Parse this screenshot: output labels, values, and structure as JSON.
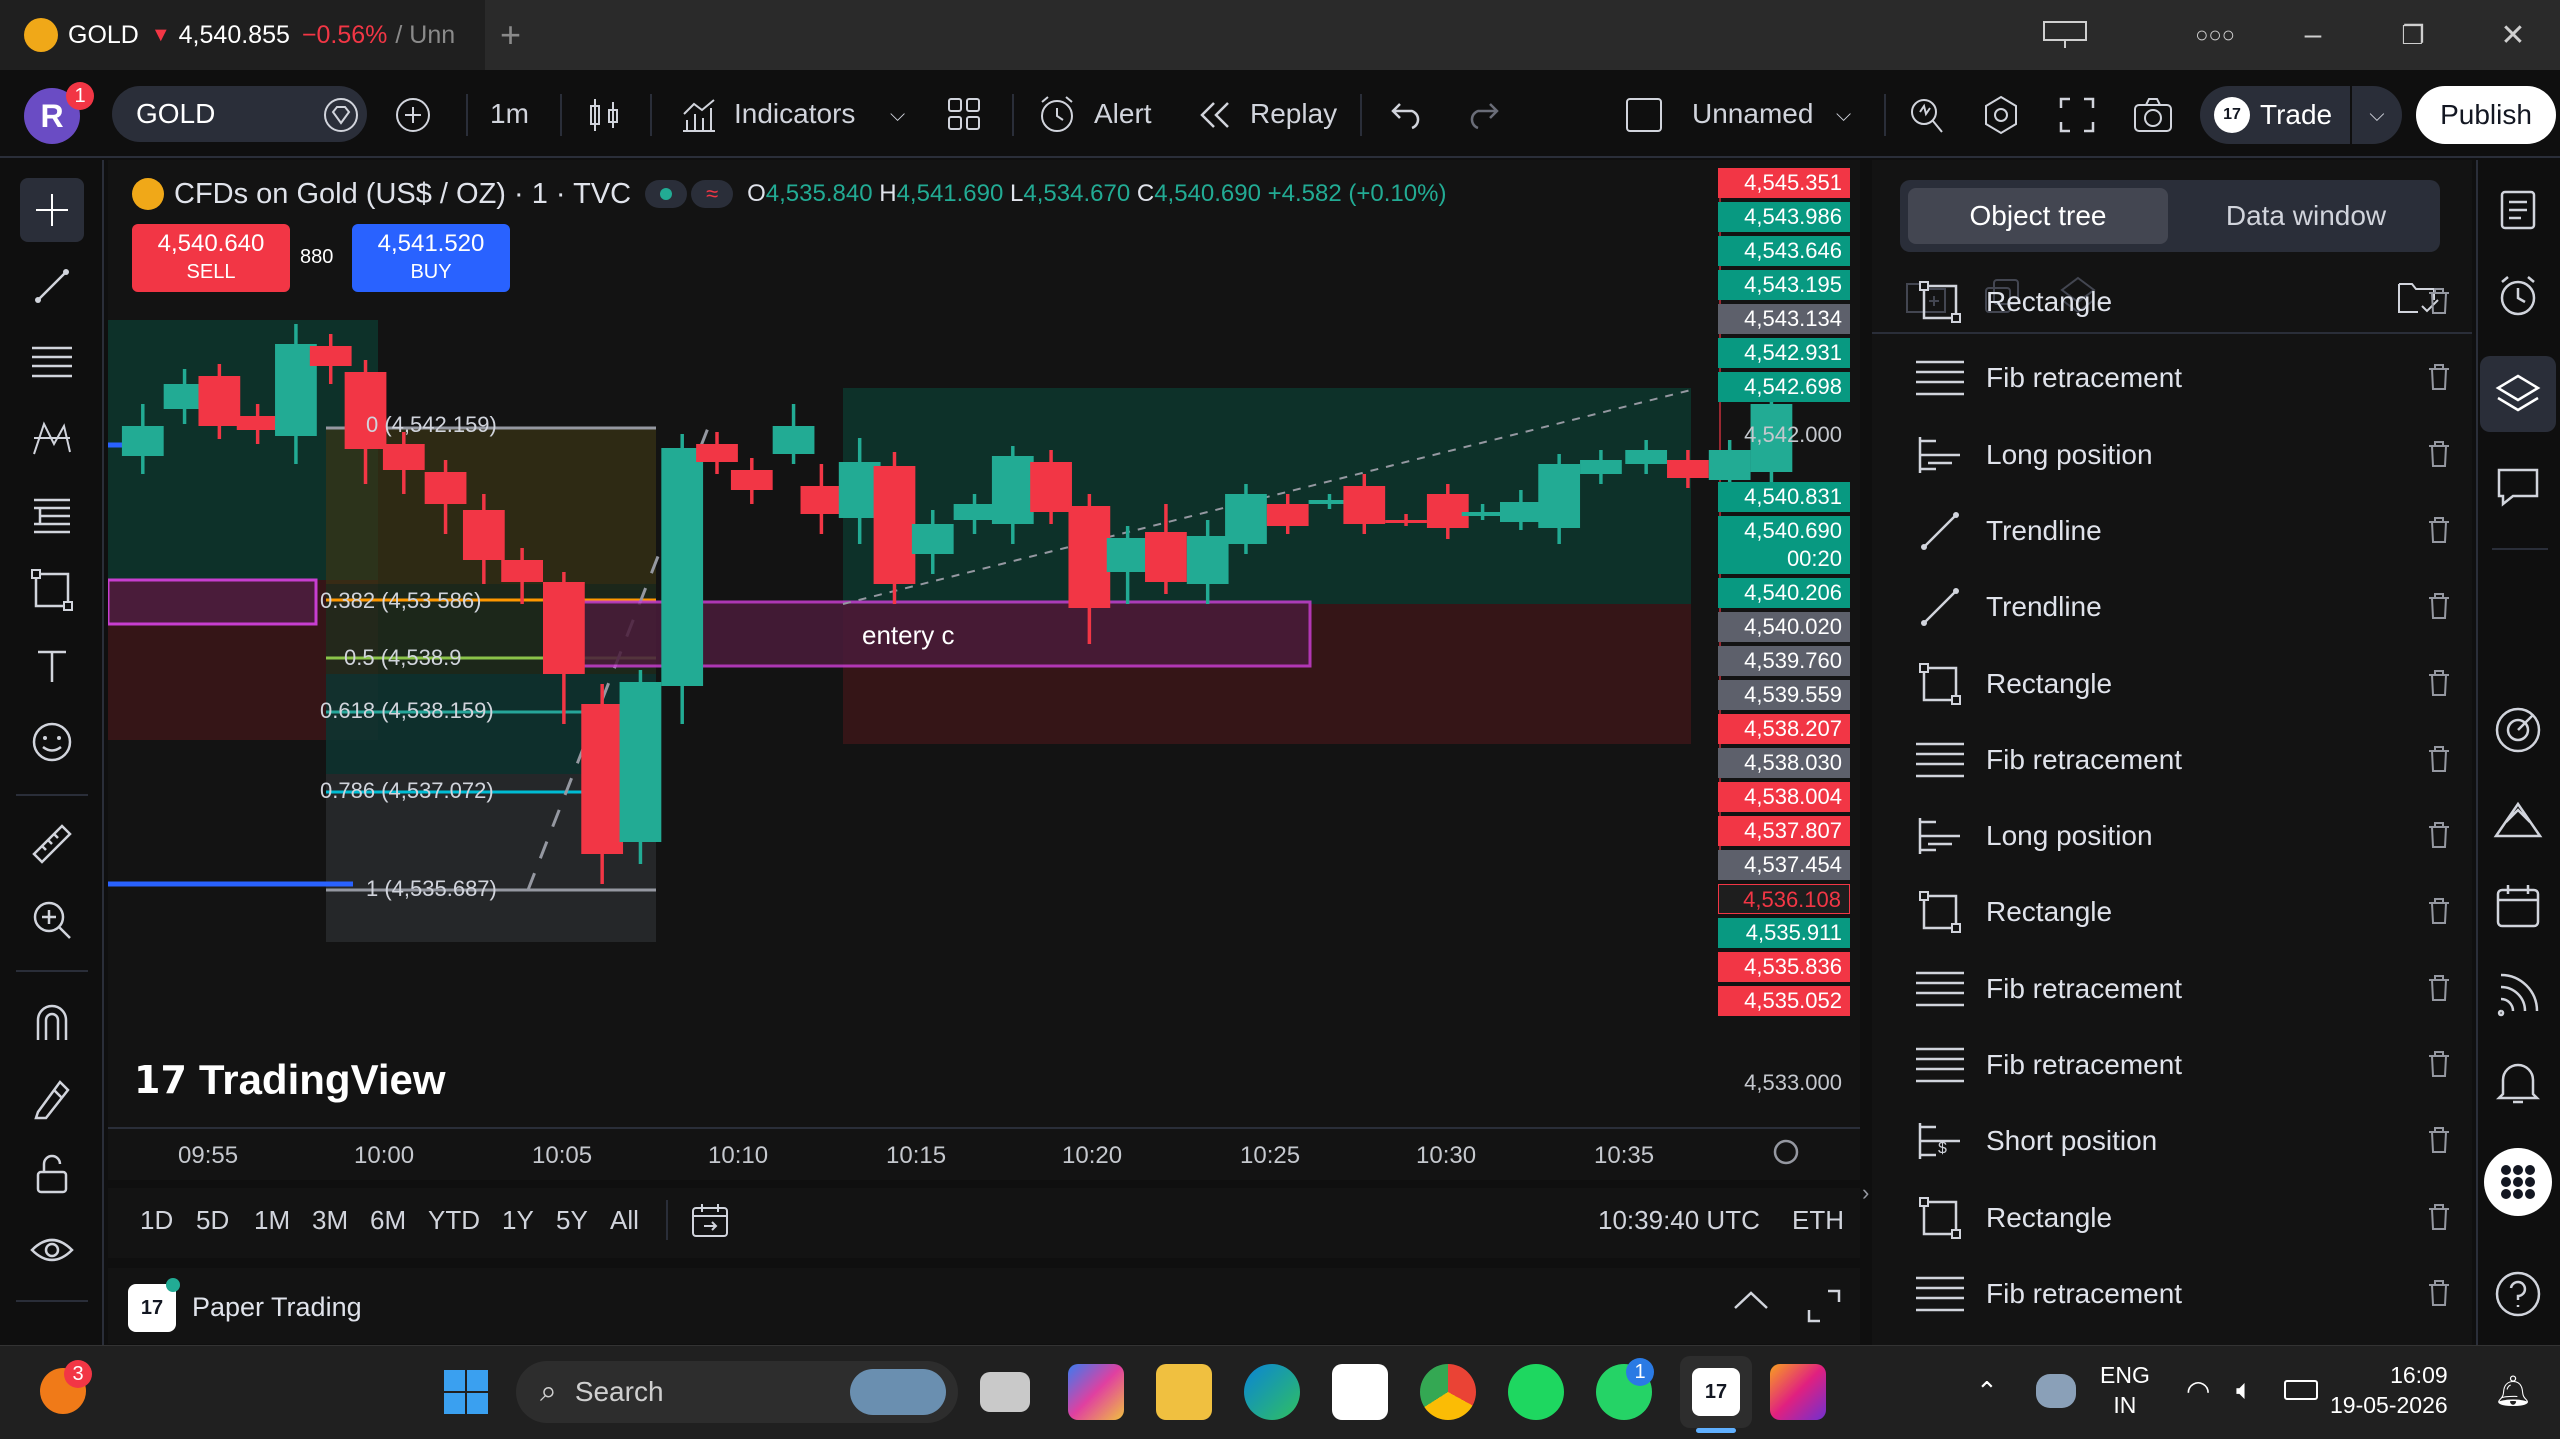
{
  "window": {
    "tab_symbol": "GOLD",
    "tab_arrow": "▼",
    "tab_price": "4,540.855",
    "tab_change": "−0.56%",
    "tab_suffix": "/ Unn"
  },
  "toolbar": {
    "avatar_letter": "R",
    "avatar_badge": "1",
    "symbol": "GOLD",
    "interval": "1m",
    "indicators": "Indicators",
    "alert": "Alert",
    "replay": "Replay",
    "layout_name": "Unnamed",
    "trade": "Trade",
    "publish": "Publish"
  },
  "chart": {
    "title": "CFDs on Gold (US$ / OZ) · 1 · TVC",
    "ohlc": {
      "o_label": "O",
      "o": "4,535.840",
      "h_label": "H",
      "h": "4,541.690",
      "l_label": "L",
      "l": "4,534.670",
      "c_label": "C",
      "c": "4,540.690",
      "change": "+4.582 (+0.10%)"
    },
    "sell_price": "4,540.640",
    "sell_label": "SELL",
    "buy_price": "4,541.520",
    "buy_label": "BUY",
    "spread": "880",
    "fib_levels": [
      {
        "label": "0 (4,542.159)",
        "color": "#9598a1"
      },
      {
        "label": "0.382 (4,53   586)",
        "color": "#ff9800"
      },
      {
        "label": "0.5 (4,538.9",
        "color": "#8bc34a"
      },
      {
        "label": "0.618 (4,538.159)",
        "color": "#26a69a"
      },
      {
        "label": "0.786 (4,537.072)",
        "color": "#00bcd4"
      },
      {
        "label": "1 (4,535.687)",
        "color": "#9598a1"
      }
    ],
    "annotation_text": "entery  c",
    "watermark": "TradingView",
    "time_labels": [
      "09:55",
      "10:00",
      "10:05",
      "10:10",
      "10:15",
      "10:20",
      "10:25",
      "10:30",
      "10:35"
    ],
    "price_labels": [
      {
        "v": "4,545.351",
        "bg": "#f23645"
      },
      {
        "v": "4,543.986",
        "bg": "#089981"
      },
      {
        "v": "4,543.646",
        "bg": "#089981"
      },
      {
        "v": "4,543.195",
        "bg": "#089981"
      },
      {
        "v": "4,543.134",
        "bg": "#5d606b"
      },
      {
        "v": "4,542.931",
        "bg": "#089981"
      },
      {
        "v": "4,542.698",
        "bg": "#089981"
      },
      {
        "v": "4,542.000",
        "bg": "transparent"
      },
      {
        "v": "4,540.831",
        "bg": "#089981"
      },
      {
        "v": "4,540.690",
        "bg": "#089981"
      },
      {
        "v": "00:20",
        "bg": "#089981"
      },
      {
        "v": "4,540.206",
        "bg": "#089981"
      },
      {
        "v": "4,540.020",
        "bg": "#5d606b"
      },
      {
        "v": "4,539.760",
        "bg": "#5d606b"
      },
      {
        "v": "4,539.559",
        "bg": "#5d606b"
      },
      {
        "v": "4,538.207",
        "bg": "#f23645"
      },
      {
        "v": "4,538.030",
        "bg": "#5d606b"
      },
      {
        "v": "4,538.004",
        "bg": "#f23645"
      },
      {
        "v": "4,537.807",
        "bg": "#f23645"
      },
      {
        "v": "4,537.454",
        "bg": "#5d606b"
      },
      {
        "v": "4,536.108",
        "bg": "#1e1e1e"
      },
      {
        "v": "4,535.911",
        "bg": "#089981"
      },
      {
        "v": "4,535.836",
        "bg": "#f23645"
      },
      {
        "v": "4,535.052",
        "bg": "#f23645"
      },
      {
        "v": "4,533.000",
        "bg": "transparent"
      }
    ]
  },
  "range_bar": {
    "ranges": [
      "1D",
      "5D",
      "1M",
      "3M",
      "6M",
      "YTD",
      "1Y",
      "5Y",
      "All"
    ],
    "time": "10:39:40 UTC",
    "session": "ETH"
  },
  "paper_trading": "Paper Trading",
  "right_panel": {
    "tab_object_tree": "Object tree",
    "tab_data_window": "Data window",
    "objects": [
      {
        "name": "Rectangle",
        "icon": "rectangle-icon"
      },
      {
        "name": "Fib retracement",
        "icon": "fib-icon"
      },
      {
        "name": "Long position",
        "icon": "long-position-icon"
      },
      {
        "name": "Trendline",
        "icon": "trendline-icon"
      },
      {
        "name": "Trendline",
        "icon": "trendline-icon"
      },
      {
        "name": "Rectangle",
        "icon": "rectangle-icon"
      },
      {
        "name": "Fib retracement",
        "icon": "fib-icon"
      },
      {
        "name": "Long position",
        "icon": "long-position-icon"
      },
      {
        "name": "Rectangle",
        "icon": "rectangle-icon"
      },
      {
        "name": "Fib retracement",
        "icon": "fib-icon"
      },
      {
        "name": "Fib retracement",
        "icon": "fib-icon"
      },
      {
        "name": "Short position",
        "icon": "short-position-icon"
      },
      {
        "name": "Rectangle",
        "icon": "rectangle-icon"
      },
      {
        "name": "Fib retracement",
        "icon": "fib-icon"
      }
    ]
  },
  "taskbar": {
    "search": "Search",
    "notif_badge": "3",
    "whatsapp_badge": "1",
    "lang1": "ENG",
    "lang2": "IN",
    "time": "16:09",
    "date": "19-05-2026"
  },
  "colors": {
    "up": "#22ab94",
    "down": "#f23645",
    "accent": "#2962ff"
  }
}
